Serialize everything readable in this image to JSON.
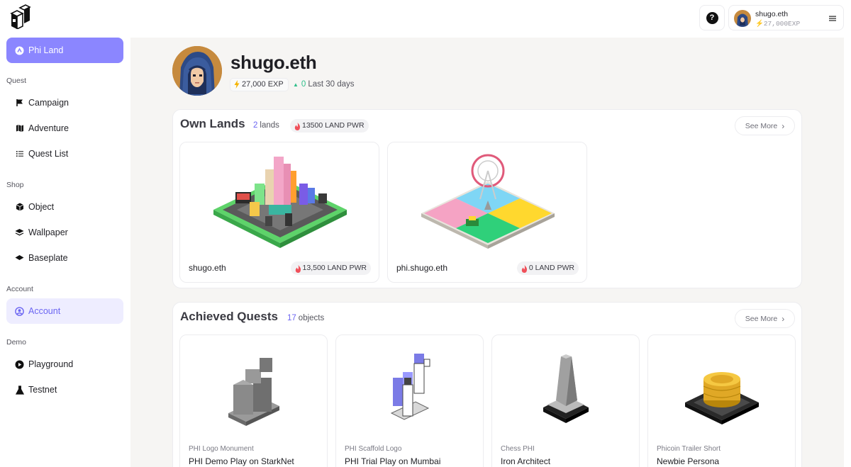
{
  "sidebar": {
    "primary": {
      "label": "Phi Land",
      "icon": "phi-land-icon"
    },
    "sections": [
      {
        "label": "Quest",
        "items": [
          {
            "label": "Campaign",
            "icon": "flag-icon"
          },
          {
            "label": "Adventure",
            "icon": "map-icon"
          },
          {
            "label": "Quest List",
            "icon": "list-icon"
          }
        ]
      },
      {
        "label": "Shop",
        "items": [
          {
            "label": "Object",
            "icon": "cube-icon"
          },
          {
            "label": "Wallpaper",
            "icon": "layers-icon"
          },
          {
            "label": "Baseplate",
            "icon": "baseplate-icon"
          }
        ]
      },
      {
        "label": "Account",
        "items": [
          {
            "label": "Account",
            "icon": "user-circle-icon",
            "active": true
          }
        ]
      },
      {
        "label": "Demo",
        "items": [
          {
            "label": "Playground",
            "icon": "play-icon"
          },
          {
            "label": "Testnet",
            "icon": "flask-icon"
          }
        ]
      }
    ]
  },
  "topbar": {
    "help_label": "?",
    "user": {
      "name": "shugo.eth",
      "exp": "27,000EXP"
    }
  },
  "profile": {
    "name": "shugo.eth",
    "exp": "27,000 EXP",
    "gain_value": "0",
    "gain_period": "Last 30 days"
  },
  "own_lands": {
    "title": "Own Lands",
    "count": "2",
    "count_unit": "lands",
    "land_pwr": "13500 LAND PWR",
    "see_more": "See More",
    "cards": [
      {
        "name": "shugo.eth",
        "pwr": "13,500 LAND PWR"
      },
      {
        "name": "phi.shugo.eth",
        "pwr": "0 LAND PWR"
      }
    ]
  },
  "achieved_quests": {
    "title": "Achieved Quests",
    "count": "17",
    "count_unit": "objects",
    "see_more": "See More",
    "cards": [
      {
        "object": "PHI Logo Monument",
        "quest": "PHI Demo Play on StarkNet"
      },
      {
        "object": "PHI Scaffold Logo",
        "quest": "PHI Trial Play on Mumbai"
      },
      {
        "object": "Chess PHI",
        "quest": "Iron Architect"
      },
      {
        "object": "Phicoin Trailer Short",
        "quest": "Newbie Persona"
      }
    ]
  },
  "colors": {
    "accent": "#8b86ff",
    "accent_text": "#6b65f2",
    "positive": "#2fbf8a",
    "fire": "#f0505a",
    "bolt": "#f5b400"
  }
}
